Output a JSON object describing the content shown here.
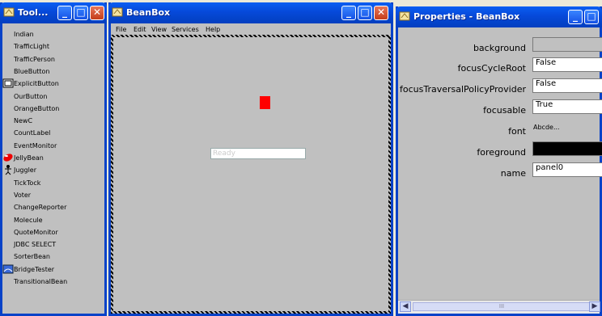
{
  "toolbox": {
    "title": "Tool...",
    "items": [
      {
        "label": "Indian",
        "icon": ""
      },
      {
        "label": "TrafficLight",
        "icon": ""
      },
      {
        "label": "TrafficPerson",
        "icon": ""
      },
      {
        "label": "BlueButton",
        "icon": ""
      },
      {
        "label": "ExplicitButton",
        "icon": "button-icon"
      },
      {
        "label": "OurButton",
        "icon": ""
      },
      {
        "label": "OrangeButton",
        "icon": ""
      },
      {
        "label": "NewC",
        "icon": ""
      },
      {
        "label": "CountLabel",
        "icon": ""
      },
      {
        "label": "EventMonitor",
        "icon": ""
      },
      {
        "label": "JellyBean",
        "icon": "jellybean-icon"
      },
      {
        "label": "Juggler",
        "icon": "juggler-icon"
      },
      {
        "label": "TickTock",
        "icon": ""
      },
      {
        "label": "Voter",
        "icon": ""
      },
      {
        "label": "ChangeReporter",
        "icon": ""
      },
      {
        "label": "Molecule",
        "icon": ""
      },
      {
        "label": "QuoteMonitor",
        "icon": ""
      },
      {
        "label": "JDBC SELECT",
        "icon": ""
      },
      {
        "label": "SorterBean",
        "icon": ""
      },
      {
        "label": "BridgeTester",
        "icon": "bridge-icon"
      },
      {
        "label": "TransitionalBean",
        "icon": ""
      }
    ]
  },
  "beanbox": {
    "title": "BeanBox",
    "menu": [
      "File",
      "Edit",
      "View",
      "Services",
      "Help"
    ],
    "ready_placeholder": "Ready",
    "bean_color": "#ff0000"
  },
  "properties": {
    "title": "Properties - BeanBox",
    "rows": [
      {
        "label": "background",
        "value": "",
        "swatch": "#c0c0c0"
      },
      {
        "label": "focusCycleRoot",
        "value": "False"
      },
      {
        "label": "focusTraversalPolicyProvider",
        "value": "False"
      },
      {
        "label": "focusable",
        "value": "True"
      },
      {
        "label": "font",
        "value": "Abcde..."
      },
      {
        "label": "foreground",
        "value": "",
        "swatch": "#000000"
      },
      {
        "label": "name",
        "value": "panel0"
      }
    ],
    "scroll_thumb": "III"
  },
  "colors": {
    "titlebar": "#0649d9",
    "panel": "#c0c0c0"
  }
}
